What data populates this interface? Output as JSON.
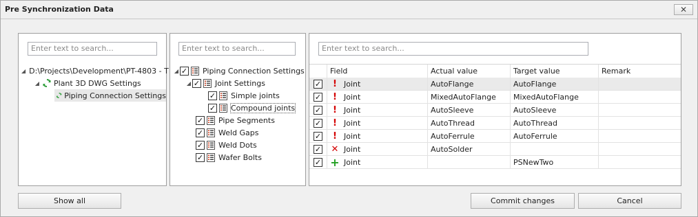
{
  "window": {
    "title": "Pre Synchronization Data",
    "close_glyph": "✕"
  },
  "left_panel": {
    "search_placeholder": "Enter text to search...",
    "nodes": [
      {
        "label": "D:\\Projects\\Development\\PT-4803 - T"
      },
      {
        "label": "Plant 3D DWG Settings"
      },
      {
        "label": "Piping Connection Settings"
      }
    ]
  },
  "middle_panel": {
    "search_placeholder": "Enter text to search...",
    "nodes": [
      {
        "label": "Piping Connection Settings",
        "checked": true
      },
      {
        "label": "Joint Settings",
        "checked": true
      },
      {
        "label": "Simple joints",
        "checked": true
      },
      {
        "label": "Compound joints",
        "checked": true
      },
      {
        "label": "Pipe Segments",
        "checked": true
      },
      {
        "label": "Weld Gaps",
        "checked": true
      },
      {
        "label": "Weld Dots",
        "checked": true
      },
      {
        "label": "Wafer Bolts",
        "checked": true
      }
    ]
  },
  "right_panel": {
    "search_placeholder": "Enter text to search...",
    "columns": [
      "Field",
      "Actual value",
      "Target value",
      "Remark"
    ],
    "rows": [
      {
        "status": "changed",
        "field": "Joint",
        "actual": "AutoFlange",
        "target": "AutoFlange",
        "remark": ""
      },
      {
        "status": "changed",
        "field": "Joint",
        "actual": "MixedAutoFlange",
        "target": "MixedAutoFlange",
        "remark": ""
      },
      {
        "status": "changed",
        "field": "Joint",
        "actual": "AutoSleeve",
        "target": "AutoSleeve",
        "remark": ""
      },
      {
        "status": "changed",
        "field": "Joint",
        "actual": "AutoThread",
        "target": "AutoThread",
        "remark": ""
      },
      {
        "status": "changed",
        "field": "Joint",
        "actual": "AutoFerrule",
        "target": "AutoFerrule",
        "remark": ""
      },
      {
        "status": "removed",
        "field": "Joint",
        "actual": "AutoSolder",
        "target": "",
        "remark": ""
      },
      {
        "status": "added",
        "field": "Joint",
        "actual": "",
        "target": "PSNewTwo",
        "remark": ""
      }
    ]
  },
  "buttons": {
    "show_all": "Show all",
    "commit": "Commit changes",
    "cancel": "Cancel"
  },
  "colors": {
    "changed": "#d40000",
    "removed": "#d40000",
    "added": "#22a022",
    "sync": "#2e9e3a",
    "list_icon": "#c43a1a"
  }
}
